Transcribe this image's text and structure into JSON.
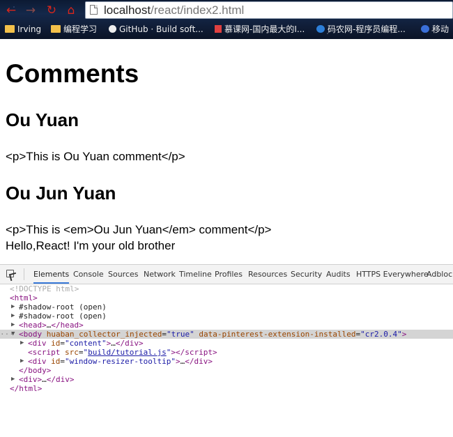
{
  "browser": {
    "url_host": "localhost",
    "url_path": "/react/index2.html",
    "bookmarks": [
      {
        "label": "Irving",
        "icon": "folder-icon"
      },
      {
        "label": "编程学习",
        "icon": "folder-icon"
      },
      {
        "label": "GitHub · Build soft...",
        "icon": "github-icon"
      },
      {
        "label": "慕课网-国内最大的I...",
        "icon": "imooc-icon"
      },
      {
        "label": "码农网-程序员编程...",
        "icon": "manong-icon"
      },
      {
        "label": "移动",
        "icon": "youdao-icon"
      }
    ]
  },
  "page": {
    "title": "Comments",
    "comments": [
      {
        "author": "Ou Yuan",
        "text": "<p>This is Ou Yuan comment</p>"
      },
      {
        "author": "Ou Jun Yuan",
        "text": "<p>This is <em>Ou Jun Yuan</em> comment</p>"
      }
    ],
    "footer_text": "Hello,React! I'm your old brother"
  },
  "devtools": {
    "tabs": [
      "Elements",
      "Console",
      "Sources",
      "Network",
      "Timeline",
      "Profiles",
      "Resources",
      "Security",
      "Audits",
      "HTTPS Everywhere",
      "Adblock"
    ],
    "active_tab": "Elements",
    "dom": {
      "doctype": "<!DOCTYPE html>",
      "html_open": "<html>",
      "shadow_root": "#shadow-root (open)",
      "head": {
        "tag_open": "<head>",
        "ellipsis": "…",
        "tag_close": "</head>"
      },
      "body": {
        "tag_name": "body",
        "attr1_name": "huaban_collector_injected",
        "attr1_value": "true",
        "attr2_name": "data-pinterest-extension-installed",
        "attr2_value": "cr2.0.4"
      },
      "div_content": {
        "tag": "div",
        "attr": "id",
        "value": "content"
      },
      "script": {
        "tag": "script",
        "attr": "src",
        "value": "build/tutorial.js"
      },
      "div_resizer": {
        "tag": "div",
        "attr": "id",
        "value": "window-resizer-tooltip"
      },
      "body_close": "</body>",
      "div_open": "<div>",
      "div_close": "</div>",
      "html_close": "</html>"
    }
  }
}
